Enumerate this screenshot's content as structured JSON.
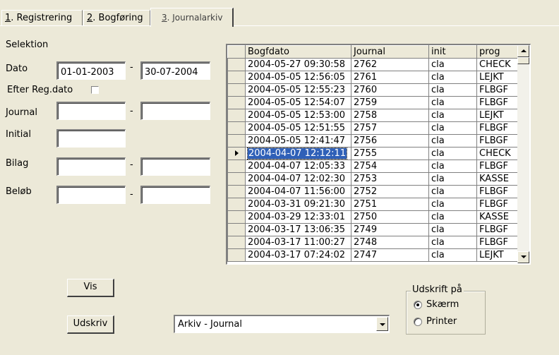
{
  "tabs": [
    {
      "num": "1",
      "label": ". Registrering"
    },
    {
      "num": "2",
      "label": ". Bogføring"
    },
    {
      "num": "3",
      "label": ". Journalarkiv"
    }
  ],
  "form": {
    "section_label": "Selektion",
    "dato_label": "Dato",
    "dato_from": "01-01-2003",
    "dato_to": "30-07-2004",
    "efter_regdato_label": "Efter Reg.dato",
    "journal_label": "Journal",
    "initial_label": "Initial",
    "bilag_label": "Bilag",
    "belob_label": "Beløb",
    "dash": "-"
  },
  "grid": {
    "columns": [
      "Bogfdato",
      "Journal",
      "init",
      "prog"
    ],
    "selected_index": 7,
    "rows": [
      [
        "2004-05-27 09:30:58",
        "2762",
        "cla",
        "CHECK"
      ],
      [
        "2004-05-05 12:56:05",
        "2761",
        "cla",
        "LEJKT"
      ],
      [
        "2004-05-05 12:55:23",
        "2760",
        "cla",
        "FLBGF"
      ],
      [
        "2004-05-05 12:54:07",
        "2759",
        "cla",
        "FLBGF"
      ],
      [
        "2004-05-05 12:53:00",
        "2758",
        "cla",
        "LEJKT"
      ],
      [
        "2004-05-05 12:51:55",
        "2757",
        "cla",
        "FLBGF"
      ],
      [
        "2004-05-05 12:41:47",
        "2756",
        "cla",
        "FLBGF"
      ],
      [
        "2004-04-07 12:12:11",
        "2755",
        "cla",
        "CHECK"
      ],
      [
        "2004-04-07 12:05:33",
        "2754",
        "cla",
        "FLBGF"
      ],
      [
        "2004-04-07 12:02:30",
        "2753",
        "cla",
        "KASSE"
      ],
      [
        "2004-04-07 11:56:00",
        "2752",
        "cla",
        "FLBGF"
      ],
      [
        "2004-03-31 09:21:30",
        "2751",
        "cla",
        "FLBGF"
      ],
      [
        "2004-03-29 12:33:01",
        "2750",
        "cla",
        "KASSE"
      ],
      [
        "2004-03-17 13:06:35",
        "2749",
        "cla",
        "FLBGF"
      ],
      [
        "2004-03-17 11:00:27",
        "2748",
        "cla",
        "FLBGF"
      ],
      [
        "2004-03-17 07:24:02",
        "2747",
        "cla",
        "LEJKT"
      ]
    ]
  },
  "buttons": {
    "vis": "Vis",
    "udskriv": "Udskriv"
  },
  "report_combo": {
    "selected": "Arkiv - Journal"
  },
  "output": {
    "title": "Udskrift på",
    "options": [
      "Skærm",
      "Printer"
    ],
    "selected": "Skærm"
  },
  "colors": {
    "background": "#ece9d8",
    "selection": "#2f60b8"
  }
}
